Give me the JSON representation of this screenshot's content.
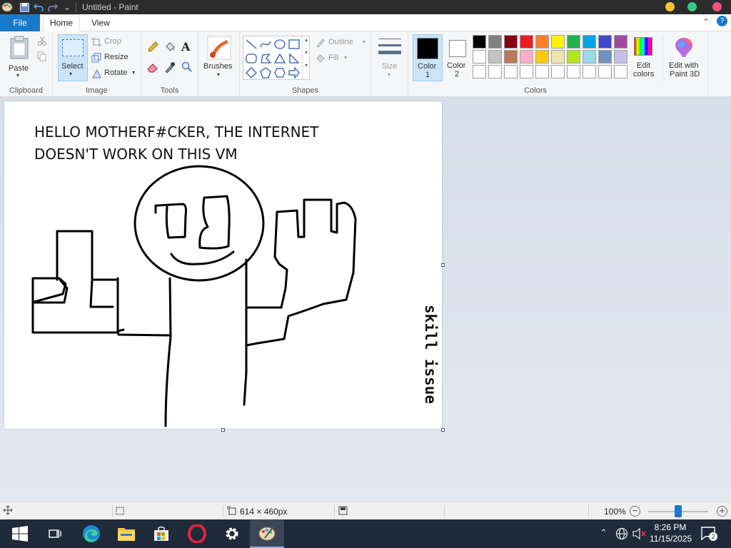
{
  "window": {
    "title": "Untitled - Paint",
    "quick_access_more": "⌄"
  },
  "tabs": {
    "file": "File",
    "home": "Home",
    "view": "View"
  },
  "ribbon": {
    "clipboard": {
      "paste": "Paste",
      "group": "Clipboard"
    },
    "image": {
      "select": "Select",
      "crop": "Crop",
      "resize": "Resize",
      "rotate": "Rotate",
      "group": "Image"
    },
    "tools": {
      "group": "Tools"
    },
    "brushes": {
      "label": "Brushes"
    },
    "shapes": {
      "outline": "Outline",
      "fill": "Fill",
      "group": "Shapes"
    },
    "size": {
      "label": "Size"
    },
    "colors": {
      "color1": "Color",
      "color1_num": "1",
      "color2": "Color",
      "color2_num": "2",
      "edit_colors_l1": "Edit",
      "edit_colors_l2": "colors",
      "edit_3d_l1": "Edit with",
      "edit_3d_l2": "Paint 3D",
      "group": "Colors",
      "color1_value": "#000000",
      "color2_value": "#ffffff",
      "palette_row1": [
        "#000000",
        "#7f7f7f",
        "#880015",
        "#ed1c24",
        "#ff7f27",
        "#fff200",
        "#22b14c",
        "#00a2e8",
        "#3f48cc",
        "#a349a4"
      ],
      "palette_row2": [
        "#ffffff",
        "#c3c3c3",
        "#b97a57",
        "#ffaec9",
        "#ffc90e",
        "#efe4b0",
        "#b5e61d",
        "#99d9ea",
        "#7092be",
        "#c8bfe7"
      ],
      "palette_row3": [
        "#ffffff",
        "#ffffff",
        "#ffffff",
        "#ffffff",
        "#ffffff",
        "#ffffff",
        "#ffffff",
        "#ffffff",
        "#ffffff",
        "#ffffff"
      ]
    }
  },
  "canvas": {
    "text_line1": "HELLO MOTHERF#CKER, THE INTERNET",
    "text_line2": "DOESN'T WORK ON THIS VM",
    "watermark": "skill issue"
  },
  "status": {
    "dimensions": "614 × 460px",
    "zoom": "100%",
    "zoom_level": 0.5
  },
  "taskbar": {
    "time": "8:26 PM",
    "date": "11/15/2025",
    "notifications": "2"
  }
}
